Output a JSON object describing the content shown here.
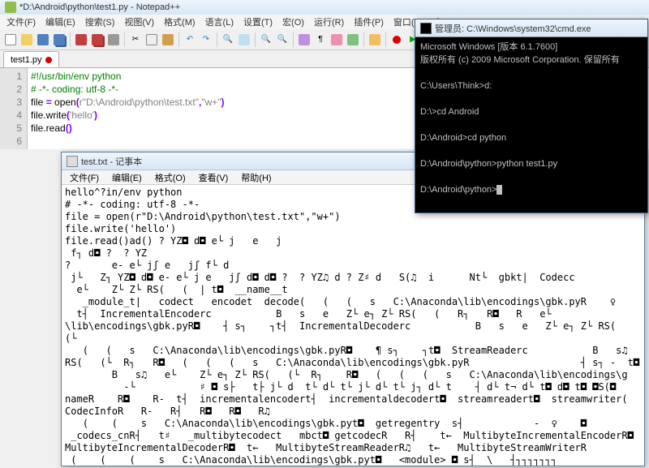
{
  "npp": {
    "title": "*D:\\Android\\python\\test1.py - Notepad++",
    "menu": [
      "文件(F)",
      "编辑(E)",
      "搜索(S)",
      "视图(V)",
      "格式(M)",
      "语言(L)",
      "设置(T)",
      "宏(O)",
      "运行(R)",
      "插件(P)",
      "窗口(W)",
      "?"
    ],
    "tab": "test1.py",
    "lines": [
      "1",
      "2",
      "3",
      "4",
      "5",
      "6"
    ],
    "code": {
      "l1": "#!/usr/bin/env python",
      "l2": "# -*- coding: utf-8 -*-",
      "l3a": "file ",
      "l3b": "=",
      "l3c": " open",
      "l3d": "(",
      "l3e": "r\"D:\\Android\\python\\test.txt\"",
      "l3f": ",",
      "l3g": "\"w+\"",
      "l3h": ")",
      "l4a": "file.write",
      "l4b": "(",
      "l4c": "'hello'",
      "l4d": ")",
      "l5a": "file.read",
      "l5b": "()"
    }
  },
  "notepad": {
    "title": "test.txt - 记事本",
    "menu": [
      "文件(F)",
      "编辑(E)",
      "格式(O)",
      "查看(V)",
      "帮助(H)"
    ],
    "body": "hello^?in/env python\n# -*- coding: utf-8 -*-\nfile = open(r\"D:\\Android\\python\\test.txt\",\"w+\")\nfile.write('hello')\nfile.read()ad() ? YZ◘ d◘ e└ j   e   j\n f┐ d◘ ?  ? YZ\n?       e- e└ jʃ e   jʃ f└ d\n j└   Z┐ YZ◘ d◘ e- e└ j e   jʃ d◘ d◘ ?  ? YZ♫ d ? Z♯ d   S(♫  i      Nt└  gbkt|  Codecc\n  e└    Z└ Z└ RS(   (  | t◘  __name__t\n   _module_t|   codect   encodet  decode(   (   (   s   C:\\Anaconda\\lib\\encodings\\gbk.pyR    ♀\n  t┤  IncrementalEncoderc           B   s   e   Z└ e┐ Z└ RS(   (   R┐   R◘   R   e└\n\\lib\\encodings\\gbk.pyR◘    ┤ s┐    ┐t┤  IncrementalDecoderc           B   s   e   Z└ e┐ Z└ RS(   (└\n   (   (   s   C:\\Anaconda\\lib\\encodings\\gbk.pyR◘    ¶ s┐    ┐t◘  StreamReaderc           B   s♫\nRS(   (└  R┐   R◘   (   (   (   s   C:\\Anaconda\\lib\\encodings\\gbk.pyR                   ┤ s┐ -  t◘\n        B   s♫   e└    Z└ e┐ Z└ RS(   (└  R┐    R◘   (   (   (   s   C:\\Anaconda\\lib\\encodings\\g\n          -└           ♯ ◘ s├   t├ j└ d  t└ d└ t└ j└ d└ t└ j┐ d└ t    ┤ d└ t¬ d└ t◘ d◘ t◘ ◘S(◘\nnameR    R◘    R-  t┤  incrementalencodert┤  incrementaldecodert◘  streamreadert◘  streamwriter(   \nCodecInfoR   R-   R┤   R◘   R◘   R♫\n   (    (    s   C:\\Anaconda\\lib\\encodings\\gbk.pyt◘  getregentry  s┤            -  ♀    ◘\n _codecs_cnR┤   t♯   _multibytecodect   mbct◘ getcodecR   R┤    t←  MultibyteIncrementalEncoderR◘\nMultibyteIncrementalDecoderR◘  t←   MultibyteStreamReaderR♫   t←   MultibyteStreamWriterR\n (    (    (    s   C:\\Anaconda\\lib\\encodings\\gbk.pyt◘   <module> ◘ s┤  \\   ┤┐┐┐┐┐┐┐\n┤└ \\┤?┤?┘┘ 蘐?燧?                              ┤ T]?嘭?\n j◘k?燣?→└┐ ◘ e-「 0◘<?                      ┐?┐ `嘭?邹  ┐          ¬◘ \\^???      ?♀-♀??\n   ◘=-?   ┐? -    ♀4◘3?└? ♀?   ♀           ◘◘"
  },
  "cmd": {
    "title": "管理员: C:\\Windows\\system32\\cmd.exe",
    "body": "Microsoft Windows [版本 6.1.7600]\n版权所有 (c) 2009 Microsoft Corporation. 保留所有\n\nC:\\Users\\Think>d:\n\nD:\\>cd Android\n\nD:\\Android>cd python\n\nD:\\Android\\python>python test1.py\n\nD:\\Android\\python>"
  }
}
